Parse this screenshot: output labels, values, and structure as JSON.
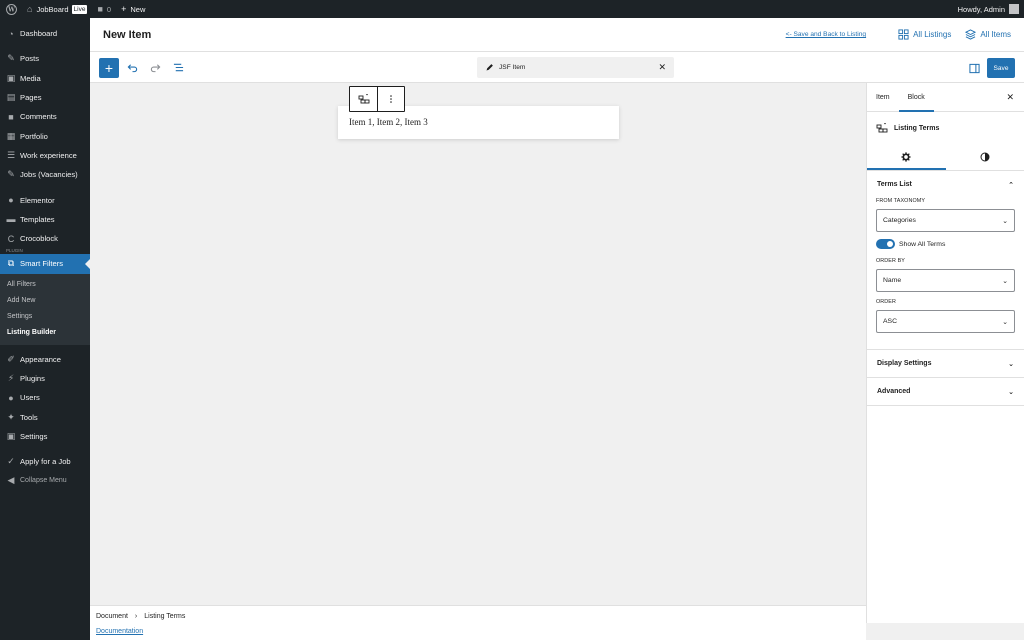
{
  "adminbar": {
    "site_name": "JobBoard",
    "live_badge": "Live",
    "comments_count": "0",
    "new_label": "New",
    "howdy": "Howdy, Admin"
  },
  "sidebar": {
    "items": [
      {
        "label": "Dashboard",
        "icon": "dashboard-icon"
      },
      {
        "label": "Posts",
        "icon": "pin-icon"
      },
      {
        "label": "Media",
        "icon": "media-icon"
      },
      {
        "label": "Pages",
        "icon": "pages-icon"
      },
      {
        "label": "Comments",
        "icon": "comment-icon"
      },
      {
        "label": "Portfolio",
        "icon": "portfolio-icon"
      },
      {
        "label": "Work experience",
        "icon": "list-icon"
      },
      {
        "label": "Jobs (Vacancies)",
        "icon": "pin-icon"
      },
      {
        "label": "Elementor",
        "icon": "elementor-icon"
      },
      {
        "label": "Templates",
        "icon": "folder-icon"
      },
      {
        "label": "Crocoblock",
        "icon": "crocoblock-icon"
      },
      {
        "label": "Smart Filters",
        "icon": "smart-filters-icon"
      },
      {
        "label": "Appearance",
        "icon": "brush-icon"
      },
      {
        "label": "Plugins",
        "icon": "plugin-icon"
      },
      {
        "label": "Users",
        "icon": "user-icon"
      },
      {
        "label": "Tools",
        "icon": "wrench-icon"
      },
      {
        "label": "Settings",
        "icon": "settings-icon"
      },
      {
        "label": "Apply for a Job",
        "icon": "check-icon"
      },
      {
        "label": "Collapse Menu",
        "icon": "collapse-icon"
      }
    ],
    "plugin_tag": "PLUGIN",
    "submenu": [
      "All Filters",
      "Add New",
      "Settings",
      "Listing Builder"
    ]
  },
  "header": {
    "title": "New Item",
    "back_link": "<- Save and Back to Listing",
    "all_listings": "All Listings",
    "all_items": "All Items"
  },
  "toolbar": {
    "doc_title": "JSF Item",
    "save_label": "Save"
  },
  "canvas": {
    "terms_text": "Item 1, Item 2, Item 3"
  },
  "footer": {
    "breadcrumb_root": "Document",
    "breadcrumb_current": "Listing Terms",
    "documentation": "Documentation"
  },
  "inspector": {
    "tab_item": "Item",
    "tab_block": "Block",
    "block_name": "Listing Terms",
    "panel_terms": "Terms List",
    "from_taxonomy_label": "FROM TAXONOMY",
    "from_taxonomy_value": "Categories",
    "show_all_terms": "Show All Terms",
    "order_by_label": "ORDER BY",
    "order_by_value": "Name",
    "order_label": "ORDER",
    "order_value": "ASC",
    "panel_display": "Display Settings",
    "panel_advanced": "Advanced"
  },
  "colors": {
    "accent": "#2271b1",
    "admin_dark": "#1d2327",
    "canvas_bg": "#f0f0f0"
  }
}
